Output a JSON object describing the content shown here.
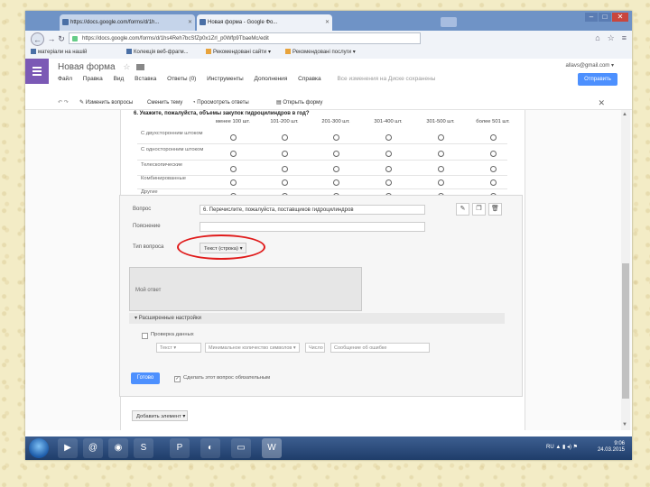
{
  "browser": {
    "tabs": [
      {
        "title": "https://docs.google.com/forms/d/1h..."
      },
      {
        "title": "Новая форма - Google Фо..."
      }
    ],
    "url": "https://docs.google.com/forms/d/1hs4Reh7bcSfZp0x1Zrl_p0Wfp9TbaeMc/edit",
    "bookmarks": [
      "матеріали на нашій",
      "Колекція веб-фрагм...",
      "Рекомендовані сайти",
      "Рекомендовані послуги"
    ]
  },
  "forms": {
    "title": "Новая форма",
    "menu": [
      "Файл",
      "Правка",
      "Вид",
      "Вставка",
      "Ответы (0)",
      "Инструменты",
      "Дополнения",
      "Справка"
    ],
    "saved_status": "Все изменения на Диске сохранены",
    "account": "allavs@gmail.com",
    "send_button": "Отправить",
    "toolbar": [
      "Изменить вопросы",
      "Сменить тему",
      "Просмотреть ответы",
      "Открыть форму"
    ]
  },
  "grid_question": {
    "title": "6. Укажите, пожалуйста, объемы закупок гидроцилиндров в год?",
    "columns": [
      "менее 100 шт.",
      "101-200 шт.",
      "201-300 шт.",
      "301-400 шт.",
      "301-500 шт.",
      "более 501 шт."
    ],
    "rows": [
      "С двухсторонним штоком",
      "С односторонним штоком",
      "Телескопические",
      "Комбинированные",
      "Другие"
    ]
  },
  "editor": {
    "question_label": "Вопрос",
    "question_value": "6. Перечислите, пожалуйста, поставщиков гидроцилиндров",
    "help_label": "Пояснение",
    "help_value": "",
    "type_label": "Тип вопроса",
    "type_value": "Текст (строка)",
    "preview_text": "Мой ответ",
    "advanced_label": "Расширенные настройки",
    "validation_label": "Проверка данных",
    "validation_type": "Текст",
    "validation_rule": "Минимальное количество символов",
    "validation_value": "Число",
    "validation_error": "Сообщение об ошибке",
    "done_button": "Готово",
    "required_label": "Сделать этот вопрос обязательным"
  },
  "add_item": "Добавить элемент",
  "clock": {
    "time": "9:06",
    "date": "24.03.2015"
  },
  "tray_lang": "RU"
}
